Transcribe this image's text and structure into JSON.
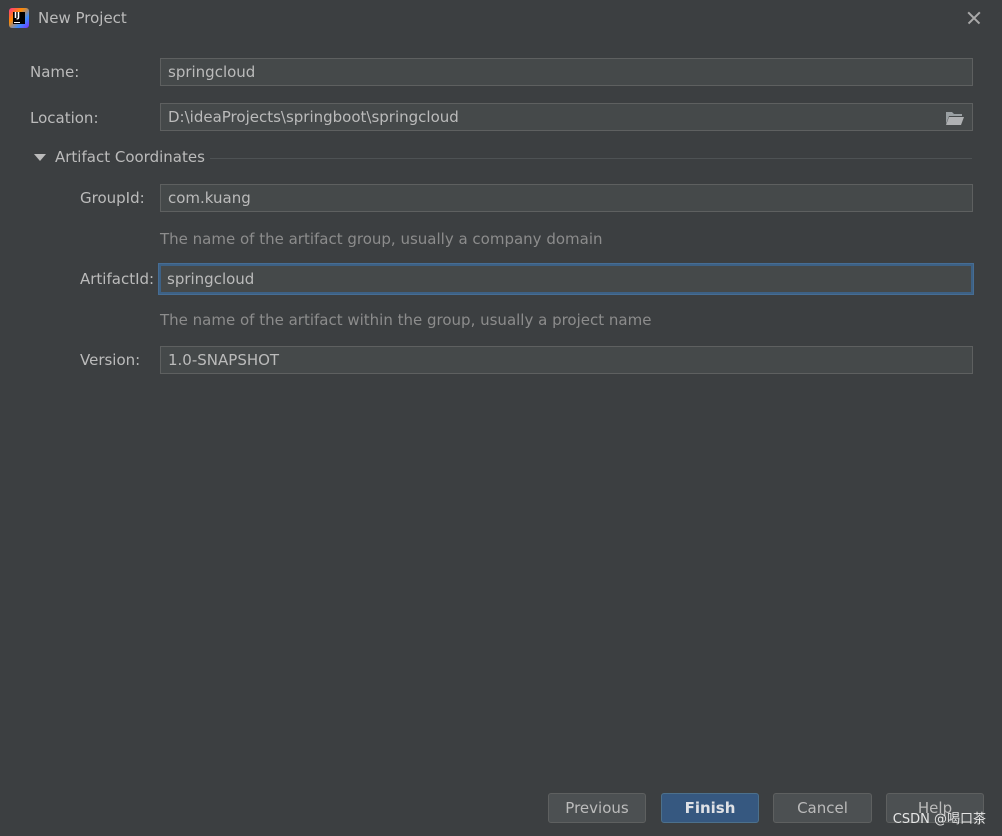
{
  "window": {
    "title": "New Project"
  },
  "form": {
    "name_label": "Name:",
    "name_value": "springcloud",
    "location_label": "Location:",
    "location_value": "D:\\ideaProjects\\springboot\\springcloud",
    "section_title": "Artifact Coordinates",
    "groupid_label": "GroupId:",
    "groupid_value": "com.kuang",
    "groupid_hint": "The name of the artifact group, usually a company domain",
    "artifactid_label": "ArtifactId:",
    "artifactid_value": "springcloud",
    "artifactid_hint": "The name of the artifact within the group, usually a project name",
    "version_label": "Version:",
    "version_value": "1.0-SNAPSHOT"
  },
  "buttons": {
    "previous": "Previous",
    "finish": "Finish",
    "cancel": "Cancel",
    "help": "Help"
  },
  "watermark": "CSDN @喝口茶",
  "icons": {
    "app": "intellij-idea-icon",
    "close": "close-icon",
    "folder": "folder-open-icon",
    "expand": "triangle-down-icon"
  },
  "colors": {
    "background": "#3c3f41",
    "field_bg": "#45494a",
    "focus_border": "#3d6185",
    "primary_button": "#365880"
  }
}
